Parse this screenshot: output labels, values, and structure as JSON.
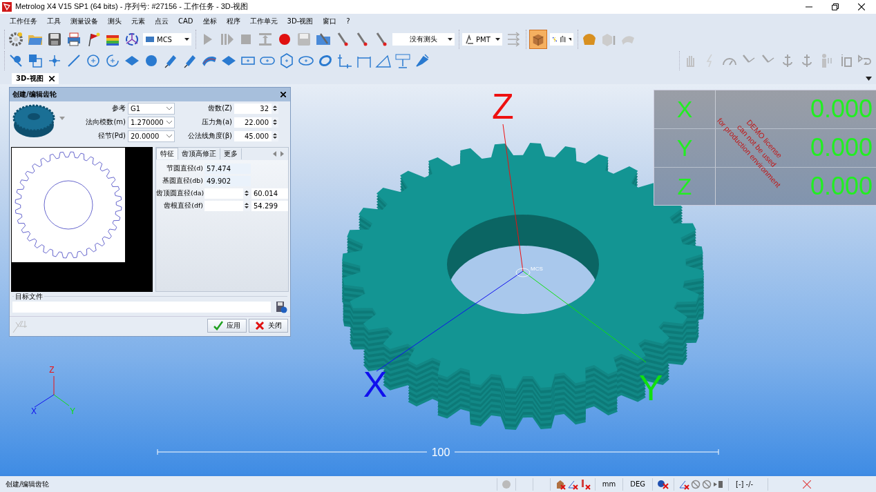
{
  "window": {
    "title": "Metrolog X4 V15 SP1 (64 bits) - 序列号: #27156 - 工作任务 - 3D-视图"
  },
  "menu": [
    "工作任务",
    "工具",
    "测量设备",
    "测头",
    "元素",
    "点云",
    "CAD",
    "坐标",
    "程序",
    "工作单元",
    "3D-视图",
    "窗口",
    "?"
  ],
  "toolbar": {
    "frame_combo": "MCS",
    "probe_combo": "没有测头",
    "machine_combo": "PMT",
    "mode_combo": "自",
    "shaded_view_on": true
  },
  "tabs": [
    {
      "label": "3D-视图",
      "selected": true
    }
  ],
  "gear_dialog": {
    "title": "创建/编辑齿轮",
    "left_fields": [
      {
        "label": "参考",
        "value": "G1"
      },
      {
        "label": "法向模数(m)",
        "value": "1.270000"
      },
      {
        "label": "径节(Pd)",
        "value": "20.0000"
      }
    ],
    "right_fields": [
      {
        "label": "齿数(Z)",
        "value": "32"
      },
      {
        "label": "压力角(a)",
        "value": "22.000"
      },
      {
        "label": "公法线角度(β)",
        "value": "45.000"
      }
    ],
    "tabs": [
      {
        "label": "特征",
        "selected": true
      },
      {
        "label": "齿顶高修正",
        "selected": false
      },
      {
        "label": "更多",
        "selected": false
      }
    ],
    "properties": [
      {
        "label": "节圆直径(d)",
        "kind": "readout",
        "value": "57.474"
      },
      {
        "label": "基圆直径(db)",
        "kind": "readout",
        "value": "49.902"
      },
      {
        "label": "齿顶圆直径(da)",
        "kind": "spin",
        "result": "60.014"
      },
      {
        "label": "齿根直径(df)",
        "kind": "spin",
        "result": "54.299"
      }
    ],
    "target_file_label": "目标文件",
    "buttons": [
      {
        "label": "应用",
        "kind": "apply"
      },
      {
        "label": "关闭",
        "kind": "close"
      }
    ]
  },
  "viewport": {
    "axes": [
      {
        "label": "Z",
        "kind": "z"
      },
      {
        "label": "X",
        "kind": "x"
      },
      {
        "label": "Y",
        "kind": "y"
      }
    ],
    "origin_label": "MCS",
    "triad": [
      {
        "label": "Z",
        "kind": "z"
      },
      {
        "label": "X",
        "kind": "x"
      },
      {
        "label": "Y",
        "kind": "y"
      }
    ],
    "scale_label": "100"
  },
  "dro": {
    "rows": [
      {
        "axis": "X",
        "value": "0.000"
      },
      {
        "axis": "Y",
        "value": "0.000"
      },
      {
        "axis": "Z",
        "value": "0.000"
      }
    ],
    "demo_notice": [
      "DEMO license",
      "can not be used",
      "for production environment"
    ]
  },
  "status_bar": {
    "message": "创建/编辑齿轮",
    "units": "mm",
    "angle": "DEG",
    "counter": "[-] -/-"
  }
}
